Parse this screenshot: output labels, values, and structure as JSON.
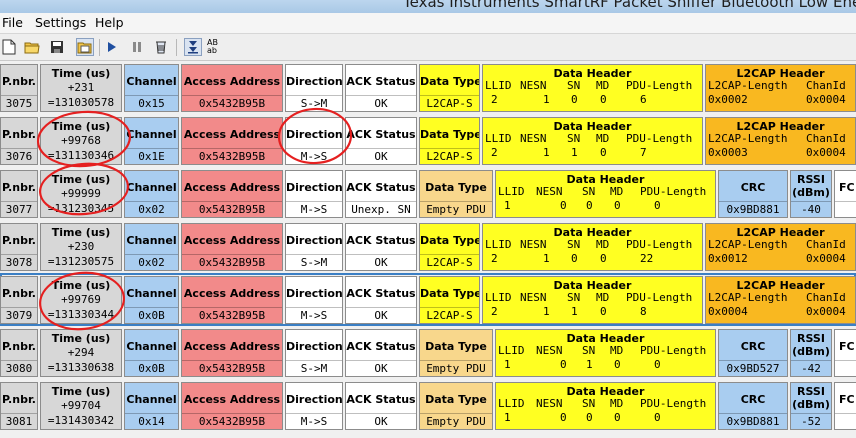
{
  "window": {
    "title": "Texas Instruments SmartRF Packet Sniffer Bluetooth Low Energy"
  },
  "menu": [
    "File",
    "Settings",
    "Help"
  ],
  "toolbar": {
    "view_toggle_label": "AB ab"
  },
  "headers": {
    "pnbr": "P.nbr.",
    "time": "Time (us)",
    "channel": "Channel",
    "access": "Access Address",
    "direction": "Direction",
    "ack": "ACK Status",
    "datatype": "Data Type",
    "dataheader": "Data Header",
    "llid": "LLID",
    "nesn": "NESN",
    "sn": "SN",
    "md": "MD",
    "pdulen": "PDU-Length",
    "l2cap": "L2CAP Header",
    "l2len": "L2CAP-Length",
    "chanid": "ChanId",
    "crc": "CRC",
    "rssi": "RSSI",
    "rssi_unit": "(dBm)",
    "fcs": "FC"
  },
  "packets": [
    {
      "pnbr": "3075",
      "delta": "+231",
      "time": "=131030578",
      "channel": "0x15",
      "access": "0x5432B95B",
      "direction": "S->M",
      "ack": "OK",
      "datatype": "L2CAP-S",
      "llid": "2",
      "nesn": "1",
      "sn": "0",
      "md": "0",
      "pdulen": "6",
      "l2len": "0x0002",
      "chanid": "0x0004"
    },
    {
      "pnbr": "3076",
      "delta": "+99768",
      "time": "=131130346",
      "channel": "0x1E",
      "access": "0x5432B95B",
      "direction": "M->S",
      "ack": "OK",
      "datatype": "L2CAP-S",
      "llid": "2",
      "nesn": "1",
      "sn": "1",
      "md": "0",
      "pdulen": "7",
      "l2len": "0x0003",
      "chanid": "0x0004"
    },
    {
      "pnbr": "3077",
      "delta": "+99999",
      "time": "=131230345",
      "channel": "0x02",
      "access": "0x5432B95B",
      "direction": "M->S",
      "ack": "Unexp. SN",
      "datatype": "Empty PDU",
      "llid": "1",
      "nesn": "0",
      "sn": "0",
      "md": "0",
      "pdulen": "0",
      "crc": "0x9BD881",
      "rssi": "-40"
    },
    {
      "pnbr": "3078",
      "delta": "+230",
      "time": "=131230575",
      "channel": "0x02",
      "access": "0x5432B95B",
      "direction": "S->M",
      "ack": "OK",
      "datatype": "L2CAP-S",
      "llid": "2",
      "nesn": "1",
      "sn": "0",
      "md": "0",
      "pdulen": "22",
      "l2len": "0x0012",
      "chanid": "0x0004"
    },
    {
      "pnbr": "3079",
      "delta": "+99769",
      "time": "=131330344",
      "channel": "0x0B",
      "access": "0x5432B95B",
      "direction": "M->S",
      "ack": "OK",
      "datatype": "L2CAP-S",
      "llid": "2",
      "nesn": "1",
      "sn": "1",
      "md": "0",
      "pdulen": "8",
      "l2len": "0x0004",
      "chanid": "0x0004"
    },
    {
      "pnbr": "3080",
      "delta": "+294",
      "time": "=131330638",
      "channel": "0x0B",
      "access": "0x5432B95B",
      "direction": "S->M",
      "ack": "OK",
      "datatype": "Empty PDU",
      "llid": "1",
      "nesn": "0",
      "sn": "1",
      "md": "0",
      "pdulen": "0",
      "crc": "0x9BD527",
      "rssi": "-42"
    },
    {
      "pnbr": "3081",
      "delta": "+99704",
      "time": "=131430342",
      "channel": "0x14",
      "access": "0x5432B95B",
      "direction": "M->S",
      "ack": "OK",
      "datatype": "Empty PDU",
      "llid": "1",
      "nesn": "0",
      "sn": "0",
      "md": "0",
      "pdulen": "0",
      "crc": "0x9BD881",
      "rssi": "-52"
    }
  ],
  "colors": {
    "gray": "#d7d7d7",
    "blue": "#a9cdf0",
    "red": "#f28a8a",
    "white": "#ffffff",
    "yellow": "#ffff22",
    "tan": "#f8d78c",
    "orange": "#f9b820",
    "annotation": "#e52020"
  }
}
